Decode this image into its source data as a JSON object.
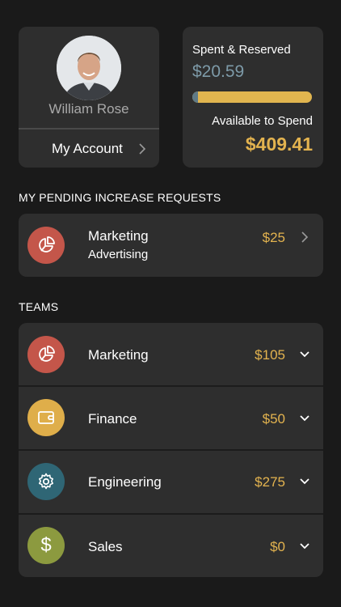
{
  "profile": {
    "name": "William Rose",
    "account_label": "My Account"
  },
  "spending": {
    "spent_title": "Spent & Reserved",
    "spent_amount": "$20.59",
    "spent_fraction": 0.05,
    "available_title": "Available to Spend",
    "available_amount": "$409.41"
  },
  "pending_section": {
    "header": "MY PENDING INCREASE REQUESTS",
    "items": [
      {
        "title": "Marketing",
        "subtitle": "Advertising",
        "amount": "$25",
        "icon": "pie-chart-icon",
        "color": "#c4564a"
      }
    ]
  },
  "teams_section": {
    "header": "TEAMS",
    "items": [
      {
        "name": "Marketing",
        "amount": "$105",
        "icon": "pie-chart-icon",
        "color": "#c4564a"
      },
      {
        "name": "Finance",
        "amount": "$50",
        "icon": "wallet-icon",
        "color": "#dfae4a"
      },
      {
        "name": "Engineering",
        "amount": "$275",
        "icon": "gear-icon",
        "color": "#2f6675"
      },
      {
        "name": "Sales",
        "amount": "$0",
        "icon": "dollar-icon",
        "color": "#8c9a3f"
      }
    ]
  },
  "colors": {
    "background": "#1a1a1a",
    "card": "#2e2e2e",
    "accent_gold": "#e3b34f",
    "accent_blue_gray": "#7d9aa8"
  }
}
